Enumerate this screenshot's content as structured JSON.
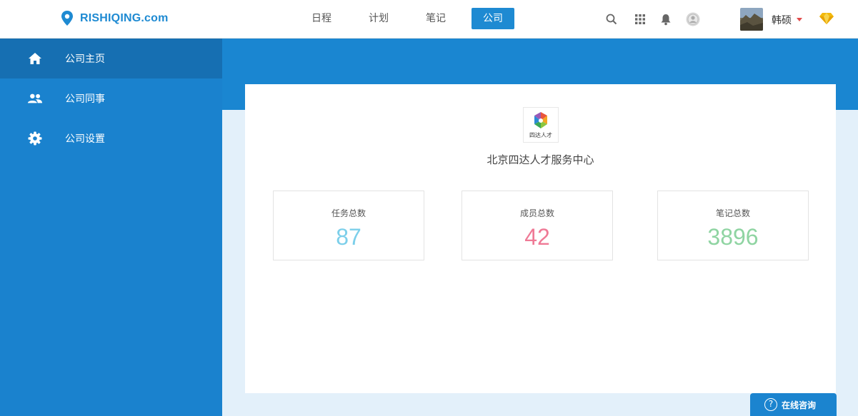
{
  "brand": {
    "name": "RISHIQING.com",
    "color": "#1e8ad2"
  },
  "nav": {
    "items": [
      {
        "label": "日程",
        "active": false
      },
      {
        "label": "计划",
        "active": false
      },
      {
        "label": "笔记",
        "active": false
      },
      {
        "label": "公司",
        "active": true
      }
    ]
  },
  "toolbar": {
    "icons": [
      "search-icon",
      "apps-grid-icon",
      "bell-icon",
      "user-circle-icon"
    ],
    "user_name": "韩硕",
    "vip_icon": "diamond-icon"
  },
  "sidebar": {
    "items": [
      {
        "label": "公司主页",
        "icon": "home-icon",
        "active": true
      },
      {
        "label": "公司同事",
        "icon": "people-icon",
        "active": false
      },
      {
        "label": "公司设置",
        "icon": "gear-icon",
        "active": false
      }
    ]
  },
  "company": {
    "logo_caption": "四达人才",
    "name": "北京四达人才服务中心"
  },
  "stats": [
    {
      "label": "任务总数",
      "value": "87",
      "color": "#7ccfea"
    },
    {
      "label": "成员总数",
      "value": "42",
      "color": "#ef7a96"
    },
    {
      "label": "笔记总数",
      "value": "3896",
      "color": "#8fd4a2"
    }
  ],
  "consult": {
    "label": "在线咨询",
    "icon_glyph": "?"
  }
}
